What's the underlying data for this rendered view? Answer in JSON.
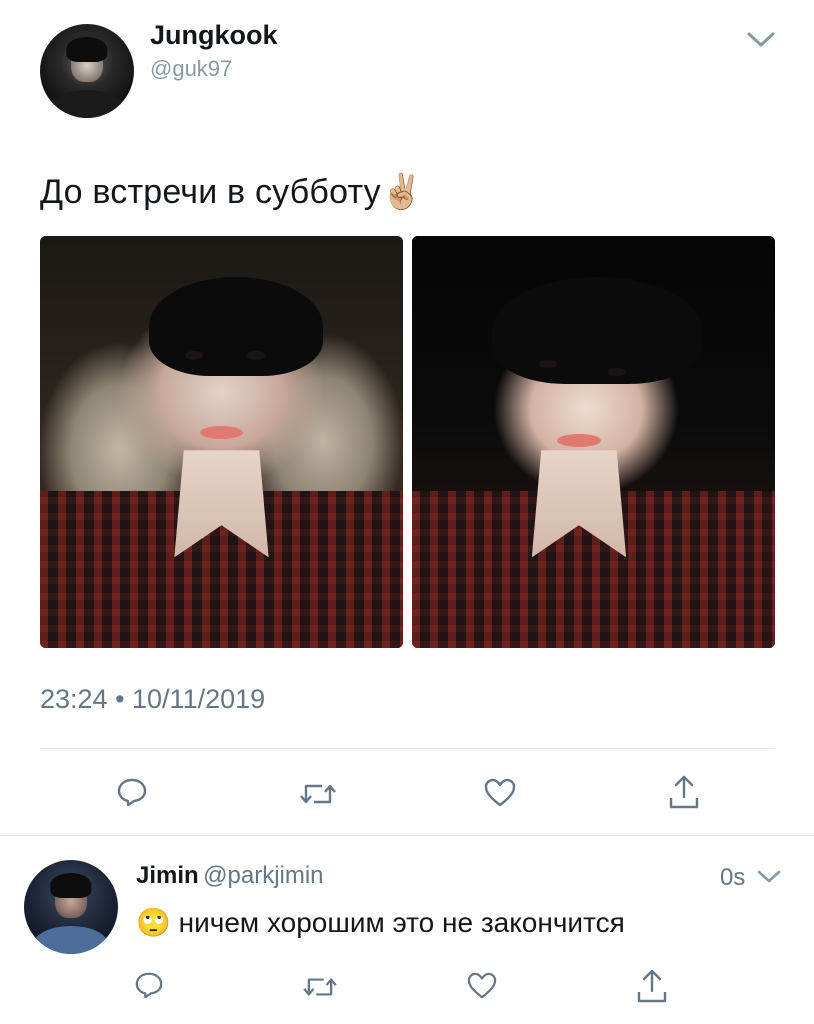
{
  "tweet": {
    "author_name": "Jungkook",
    "author_handle": "@guk97",
    "text": "До встречи в субботу",
    "emoji": "✌🏼",
    "timestamp": "23:24 • 10/11/2019",
    "icons": [
      "chevron-down-icon",
      "reply-icon",
      "retweet-icon",
      "like-icon",
      "share-icon"
    ]
  },
  "reply": {
    "author_name": "Jimin",
    "author_handle": "@parkjimin",
    "time": "0s",
    "emoji": "🙄",
    "text": "ничем хорошим это не закончится",
    "icons": [
      "chevron-down-icon",
      "reply-icon",
      "retweet-icon",
      "like-icon",
      "share-icon"
    ]
  },
  "colors": {
    "text": "#14171a",
    "secondary": "#657786",
    "divider": "#e1e8ed",
    "icon": "#657786"
  }
}
